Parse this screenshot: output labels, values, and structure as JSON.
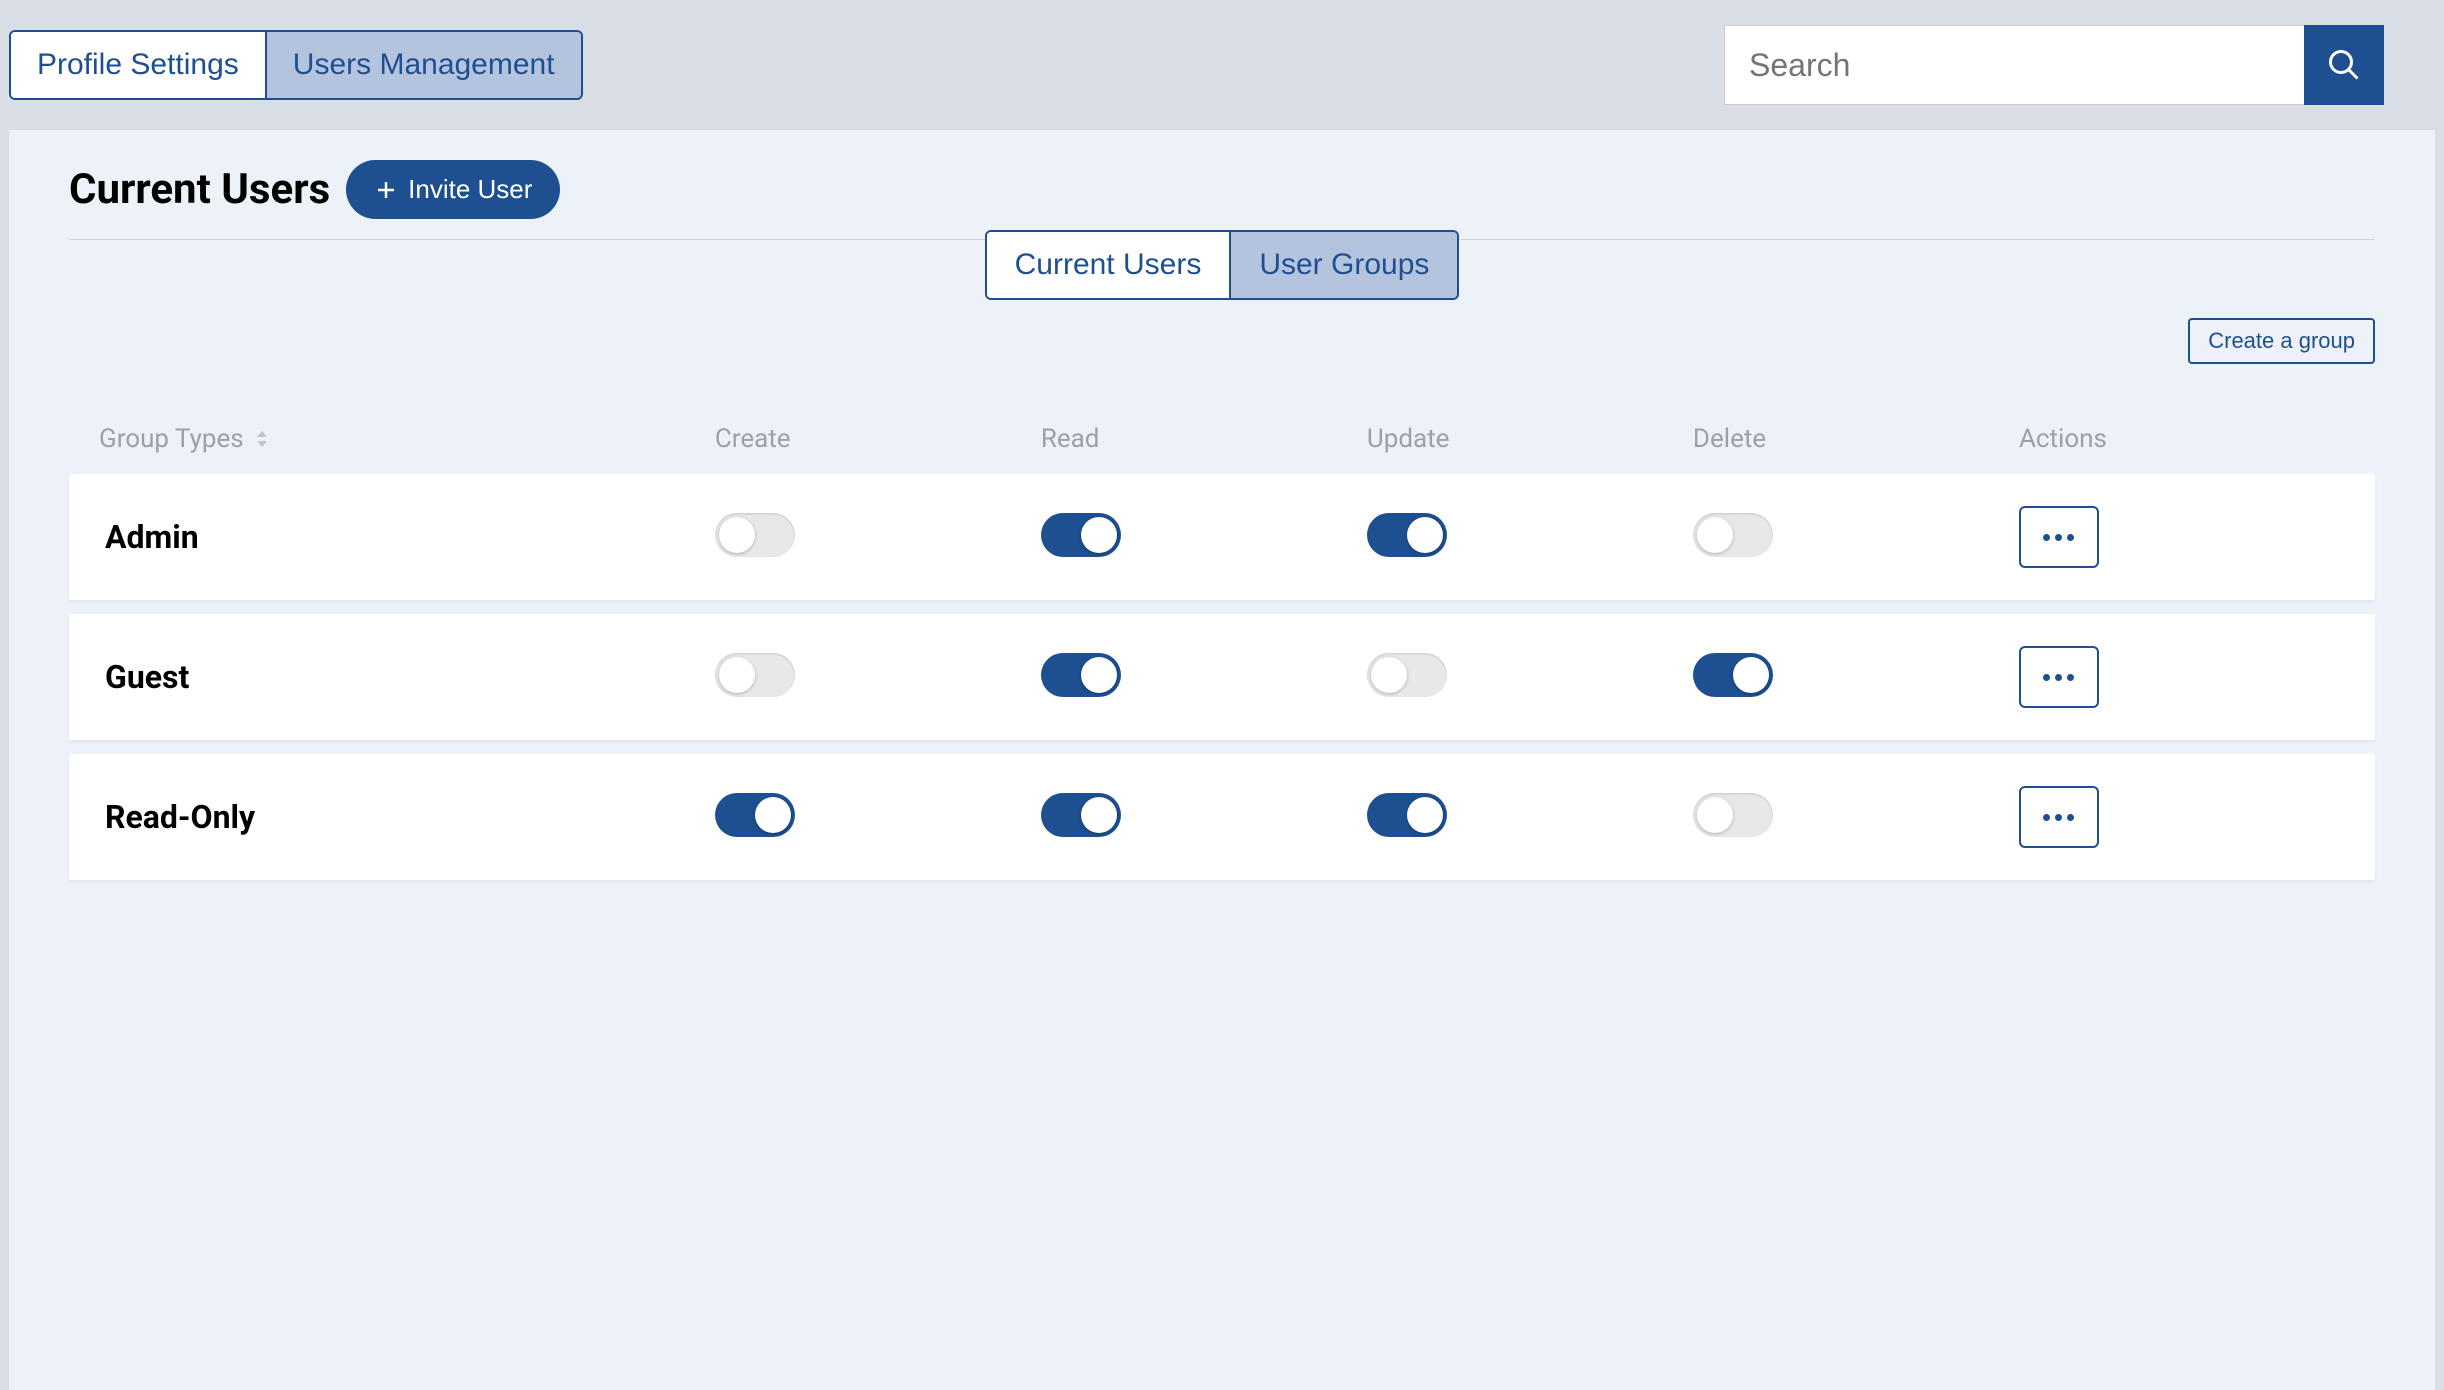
{
  "header": {
    "tabs": [
      {
        "label": "Profile Settings",
        "active": false
      },
      {
        "label": "Users Management",
        "active": true
      }
    ],
    "search_placeholder": "Search"
  },
  "page": {
    "title": "Current Users",
    "invite_label": "Invite User",
    "sub_tabs": [
      {
        "label": "Current Users",
        "active": false
      },
      {
        "label": "User Groups",
        "active": true
      }
    ],
    "create_group_label": "Create a group"
  },
  "table": {
    "columns": {
      "group_types": "Group Types",
      "create": "Create",
      "read": "Read",
      "update": "Update",
      "delete": "Delete",
      "actions": "Actions"
    },
    "rows": [
      {
        "name": "Admin",
        "create": false,
        "read": true,
        "update": true,
        "delete": false
      },
      {
        "name": "Guest",
        "create": false,
        "read": true,
        "update": false,
        "delete": true
      },
      {
        "name": "Read-Only",
        "create": true,
        "read": true,
        "update": true,
        "delete": false
      }
    ]
  }
}
